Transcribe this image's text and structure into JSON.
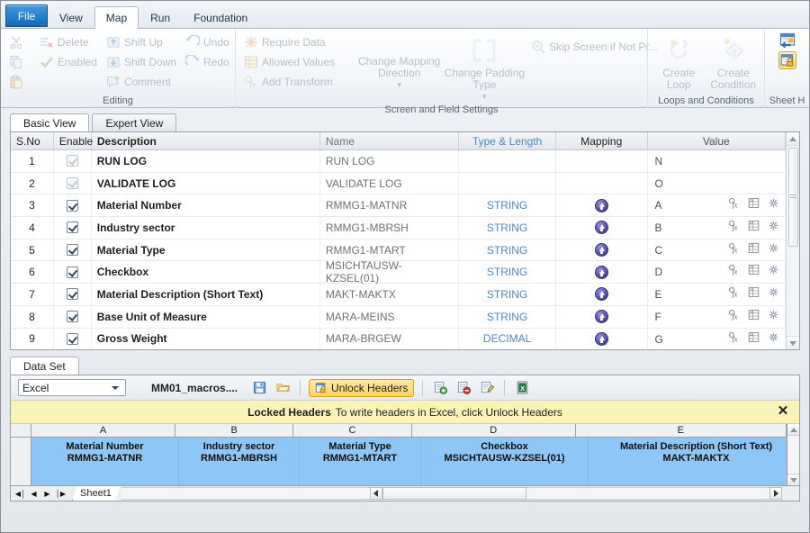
{
  "ribbon": {
    "tabs": [
      {
        "label": "File",
        "active": false,
        "kind": "file"
      },
      {
        "label": "View",
        "active": false
      },
      {
        "label": "Map",
        "active": true
      },
      {
        "label": "Run",
        "active": false
      },
      {
        "label": "Foundation",
        "active": false
      }
    ],
    "groups": [
      {
        "title": "Editing",
        "items": [
          {
            "label": "",
            "icon": "cut-icon"
          },
          {
            "label": "",
            "icon": "copy-icon"
          },
          {
            "label": "",
            "icon": "paste-icon"
          },
          {
            "label": "Delete",
            "icon": "delete-row-icon"
          },
          {
            "label": "Enabled",
            "icon": "check-icon"
          },
          {
            "label": "Shift Up",
            "icon": "shift-up-icon"
          },
          {
            "label": "Shift Down",
            "icon": "shift-down-icon"
          },
          {
            "label": "Comment",
            "icon": "comment-icon"
          },
          {
            "label": "Undo",
            "icon": "undo-icon"
          },
          {
            "label": "Redo",
            "icon": "redo-icon"
          }
        ]
      },
      {
        "title": "Screen and Field Settings",
        "items": [
          {
            "label": "Require Data",
            "icon": "require-data-icon"
          },
          {
            "label": "Allowed Values",
            "icon": "allowed-values-icon"
          },
          {
            "label": "Add Transform",
            "icon": "add-transform-icon"
          },
          {
            "label": "Change Mapping Direction",
            "icon": "mapping-direction-icon"
          },
          {
            "label": "Change Padding Type",
            "icon": "padding-type-icon"
          },
          {
            "label": "Skip Screen if Not Pr...",
            "icon": "skip-screen-icon"
          }
        ]
      },
      {
        "title": "Loops and Conditions",
        "items": [
          {
            "label": "Create Loop",
            "icon": "create-loop-icon"
          },
          {
            "label": "Create Condition",
            "icon": "create-condition-icon"
          }
        ]
      },
      {
        "title": "Sheet H",
        "items": [
          {
            "label": "",
            "icon": "write-headers-icon"
          },
          {
            "label": "",
            "icon": "lock-headers-icon"
          }
        ]
      }
    ]
  },
  "view_tabs": [
    {
      "label": "Basic View",
      "active": true
    },
    {
      "label": "Expert View",
      "active": false
    }
  ],
  "field_grid": {
    "columns": [
      "S.No",
      "Enable",
      "Description",
      "Name",
      "Type & Length",
      "Mapping",
      "Value"
    ],
    "rows": [
      {
        "sno": "1",
        "enabled": true,
        "locked": true,
        "description": "RUN LOG",
        "name": "RUN LOG",
        "type": "",
        "mapping": false,
        "value": "N",
        "icons": false
      },
      {
        "sno": "2",
        "enabled": true,
        "locked": true,
        "description": "VALIDATE LOG",
        "name": "VALIDATE LOG",
        "type": "",
        "mapping": false,
        "value": "O",
        "icons": false
      },
      {
        "sno": "3",
        "enabled": true,
        "locked": false,
        "description": "Material Number",
        "name": "RMMG1-MATNR",
        "type": "STRING",
        "mapping": true,
        "value": "A",
        "icons": true
      },
      {
        "sno": "4",
        "enabled": true,
        "locked": false,
        "description": "Industry sector",
        "name": "RMMG1-MBRSH",
        "type": "STRING",
        "mapping": true,
        "value": "B",
        "icons": true
      },
      {
        "sno": "5",
        "enabled": true,
        "locked": false,
        "description": "Material Type",
        "name": "RMMG1-MTART",
        "type": "STRING",
        "mapping": true,
        "value": "C",
        "icons": true
      },
      {
        "sno": "6",
        "enabled": true,
        "locked": false,
        "description": "Checkbox",
        "name": "MSICHTAUSW-KZSEL(01)",
        "type": "STRING",
        "mapping": true,
        "value": "D",
        "icons": true
      },
      {
        "sno": "7",
        "enabled": true,
        "locked": false,
        "description": "Material Description (Short Text)",
        "name": "MAKT-MAKTX",
        "type": "STRING",
        "mapping": true,
        "value": "E",
        "icons": true
      },
      {
        "sno": "8",
        "enabled": true,
        "locked": false,
        "description": "Base Unit of Measure",
        "name": "MARA-MEINS",
        "type": "STRING",
        "mapping": true,
        "value": "F",
        "icons": true
      },
      {
        "sno": "9",
        "enabled": true,
        "locked": false,
        "description": "Gross Weight",
        "name": "MARA-BRGEW",
        "type": "DECIMAL",
        "mapping": true,
        "value": "G",
        "icons": true
      }
    ]
  },
  "data_set": {
    "tab_label": "Data Set",
    "source_select": {
      "value": "Excel"
    },
    "file_name": "MM01_macros....",
    "buttons": [
      {
        "label": "",
        "icon": "save-icon"
      },
      {
        "label": "",
        "icon": "open-folder-icon"
      },
      {
        "label": "Unlock Headers",
        "icon": "unlock-headers-icon"
      },
      {
        "label": "",
        "icon": "add-row-icon"
      },
      {
        "label": "",
        "icon": "remove-row-icon"
      },
      {
        "label": "",
        "icon": "edit-row-icon"
      },
      {
        "label": "",
        "icon": "excel-icon"
      }
    ],
    "banner": {
      "bold": "Locked Headers",
      "text": "To write headers in Excel, click Unlock Headers",
      "close": "✕"
    },
    "sheet": {
      "column_letters": [
        "A",
        "B",
        "C",
        "D",
        "E"
      ],
      "header_cells": [
        {
          "title": "Material Number",
          "field": "RMMG1-MATNR"
        },
        {
          "title": "Industry sector",
          "field": "RMMG1-MBRSH"
        },
        {
          "title": "Material Type",
          "field": "RMMG1-MTART"
        },
        {
          "title": "Checkbox",
          "field": "MSICHTAUSW-KZSEL(01)"
        },
        {
          "title": "Material Description (Short Text)",
          "field": "MAKT-MAKTX"
        }
      ],
      "tab_name": "Sheet1",
      "nav": [
        "◀│",
        "◀",
        "▶",
        "│▶"
      ]
    }
  },
  "colors": {
    "accent_blue": "#1569b8",
    "selection_blue": "#8ec7f7",
    "banner_yellow": "#faf3b8",
    "unlock_yellow": "#ffd45e",
    "type_link": "#4e87c7",
    "mapping_purple": "#4b3f9e"
  }
}
